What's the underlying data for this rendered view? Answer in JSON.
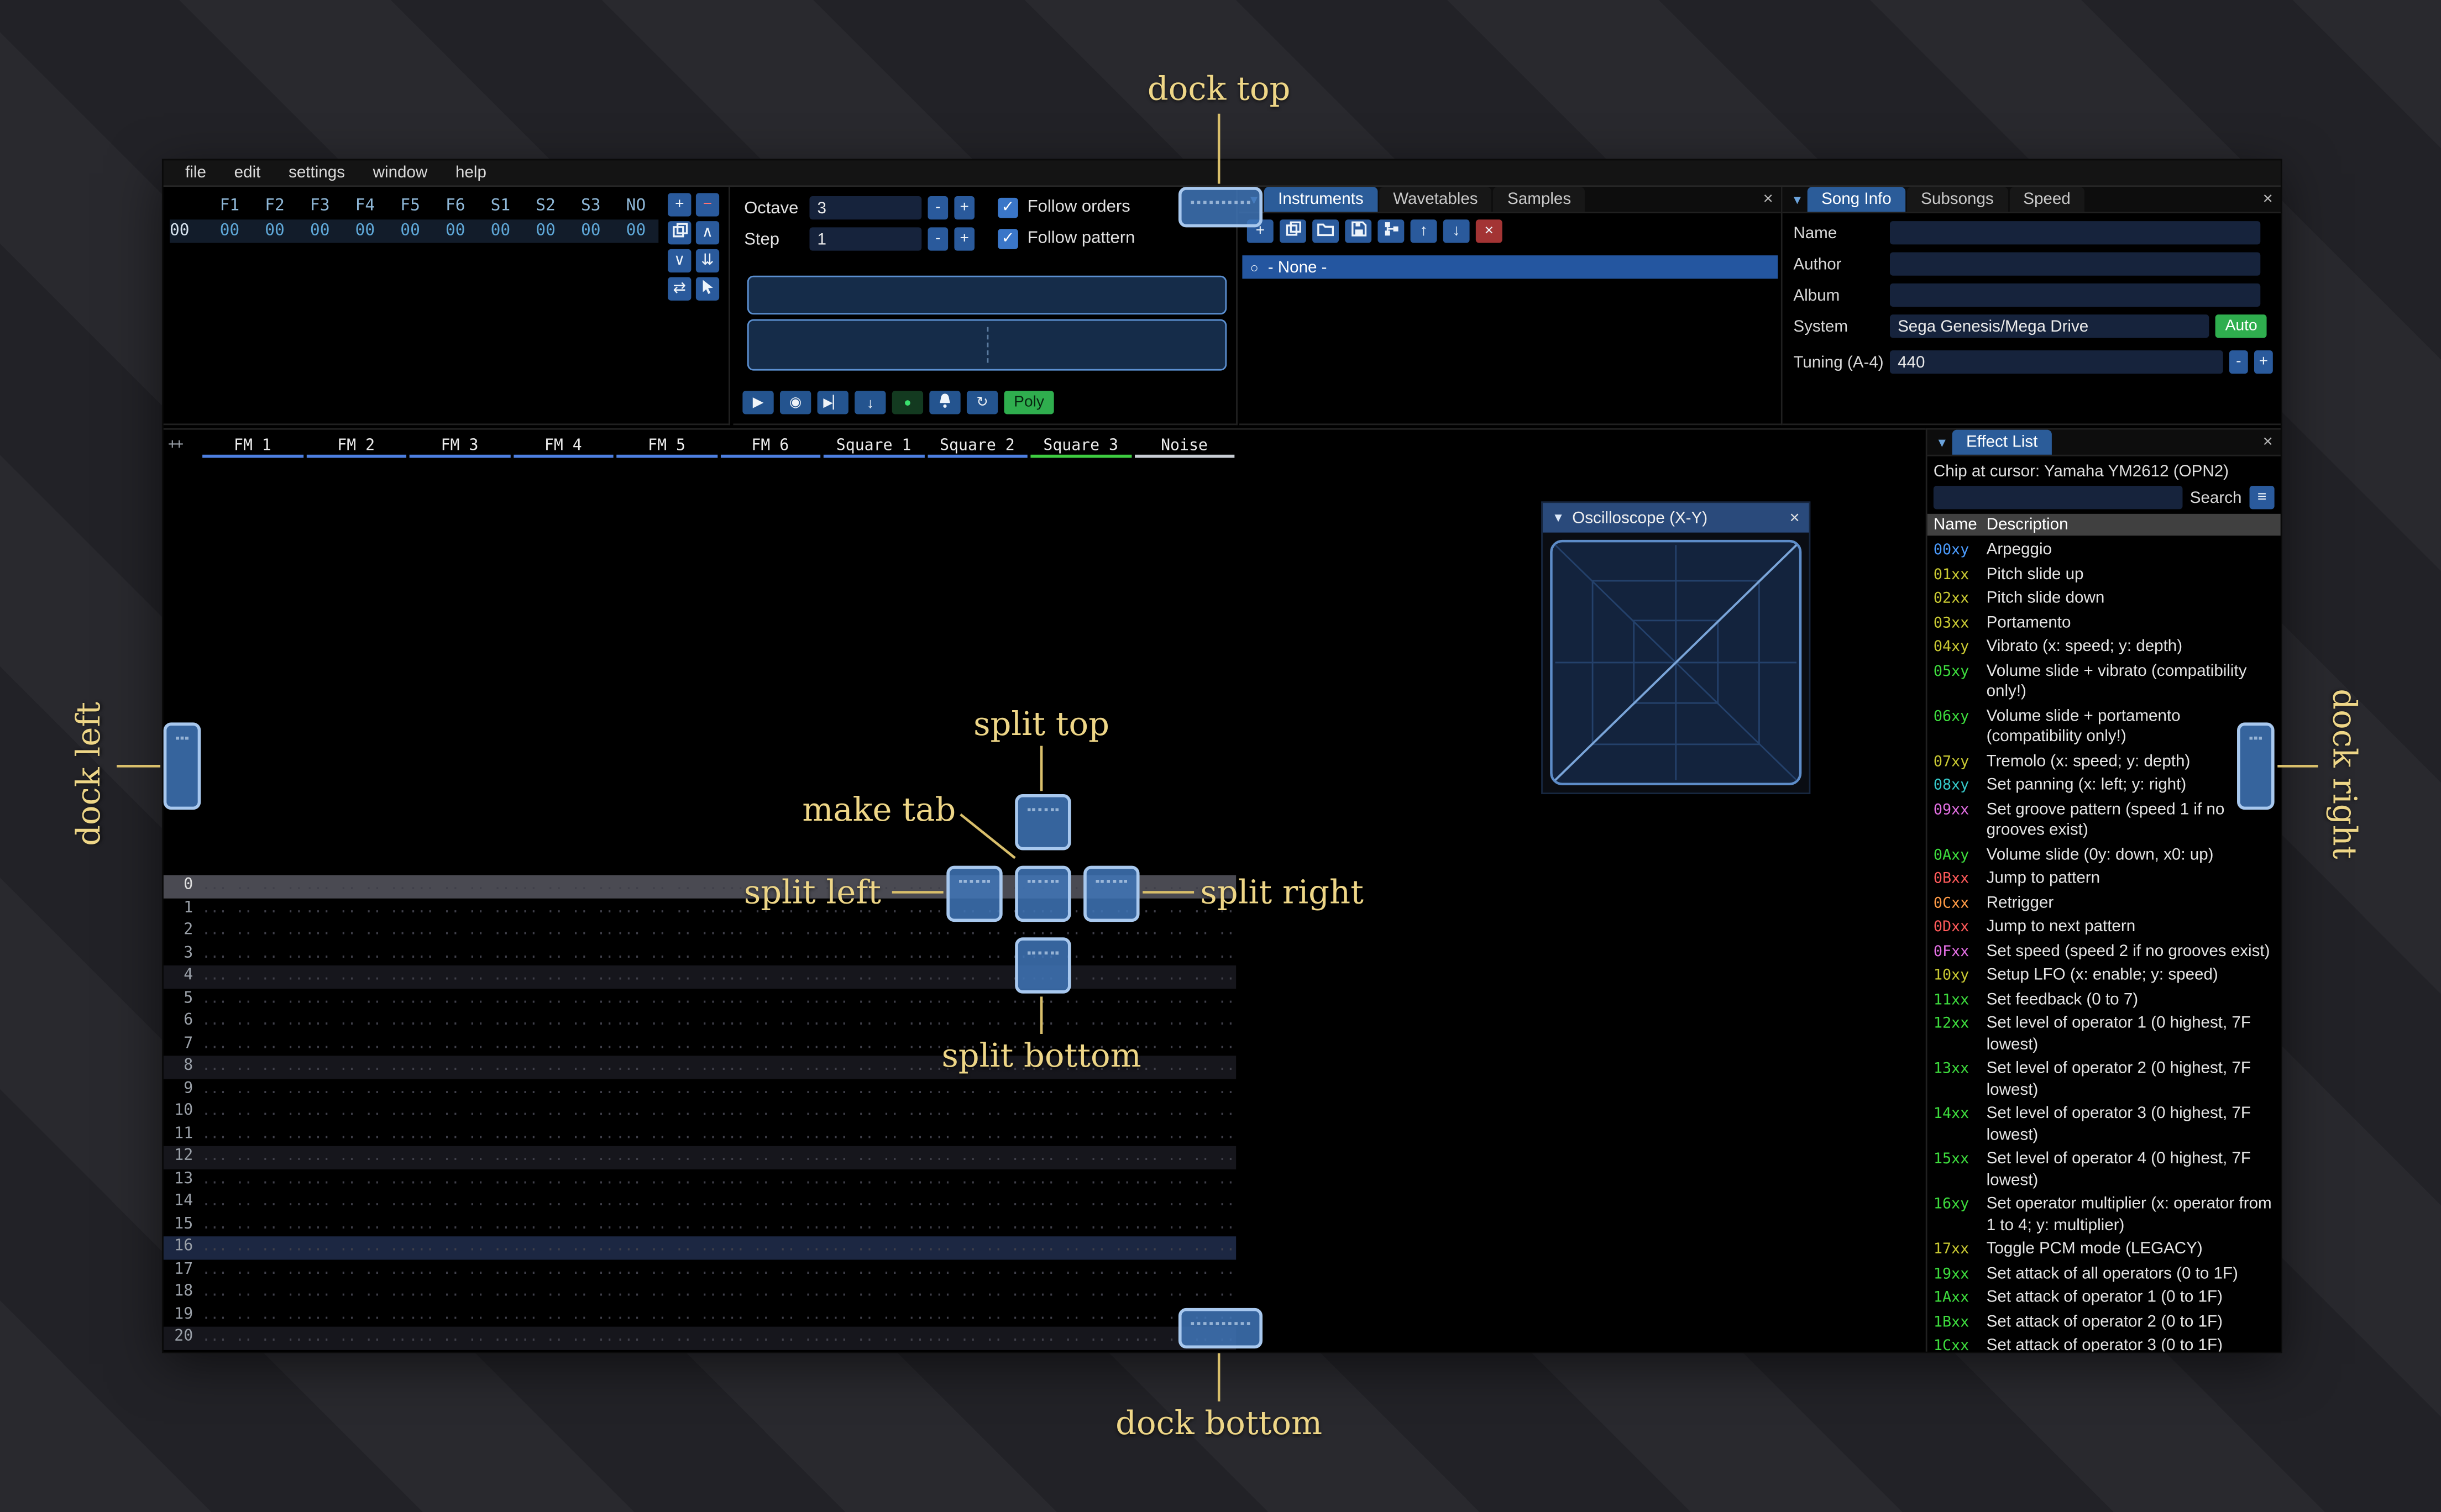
{
  "window": {
    "menu": [
      "file",
      "edit",
      "settings",
      "window",
      "help"
    ]
  },
  "icons": {
    "check": "✓",
    "collapse": "▼",
    "close": "×",
    "plus": "+",
    "minus": "−",
    "chevron_up": "∧",
    "chevron_down": "∨",
    "double_down": "⇊",
    "exchange": "⇄",
    "arrow_up": "↑",
    "arrow_down": "↓",
    "play": "▶",
    "play_pattern": "◉",
    "step": "▶▏",
    "step_row": "↓",
    "edit": "●",
    "repeat": "↻",
    "menu": "≡",
    "radio": "○"
  },
  "orders": {
    "row_index": "00",
    "channel_headers": [
      "F1",
      "F2",
      "F3",
      "F4",
      "F5",
      "F6",
      "S1",
      "S2",
      "S3",
      "NO"
    ],
    "row_values": [
      "00",
      "00",
      "00",
      "00",
      "00",
      "00",
      "00",
      "00",
      "00",
      "00"
    ]
  },
  "play_controls": {
    "octave_label": "Octave",
    "octave_value": "3",
    "step_label": "Step",
    "step_value": "1",
    "minus_label": "-",
    "plus_label": "+",
    "follow_orders_label": "Follow orders",
    "follow_pattern_label": "Follow pattern",
    "poly_label": "Poly"
  },
  "instruments_panel": {
    "tabs": [
      "Instruments",
      "Wavetables",
      "Samples"
    ],
    "active_tab": "Instruments",
    "selected_item": "- None -"
  },
  "song_info": {
    "tabs": [
      "Song Info",
      "Subsongs",
      "Speed"
    ],
    "active_tab": "Song Info",
    "fields": [
      {
        "label": "Name",
        "value": ""
      },
      {
        "label": "Author",
        "value": ""
      },
      {
        "label": "Album",
        "value": ""
      },
      {
        "label": "System",
        "value": "Sega Genesis/Mega Drive",
        "button": "Auto"
      },
      {
        "label": "Tuning (A-4)",
        "value": "440",
        "stepper": true
      }
    ]
  },
  "pattern": {
    "corner_label": "++",
    "channels": [
      {
        "name": "FM 1",
        "color": "#4d7fe0"
      },
      {
        "name": "FM 2",
        "color": "#4d7fe0"
      },
      {
        "name": "FM 3",
        "color": "#4d7fe0"
      },
      {
        "name": "FM 4",
        "color": "#4d7fe0"
      },
      {
        "name": "FM 5",
        "color": "#4d7fe0"
      },
      {
        "name": "FM 6",
        "color": "#4d7fe0"
      },
      {
        "name": "Square 1",
        "color": "#4d7fe0"
      },
      {
        "name": "Square 2",
        "color": "#4d7fe0"
      },
      {
        "name": "Square 3",
        "color": "#3ecc41"
      },
      {
        "name": "Noise",
        "color": "#c8cdd4"
      }
    ],
    "rows": 22,
    "empty_cell": "... .. .. ..",
    "highlight": {
      "cursor_row": 0,
      "minor_every": 4,
      "major_every": 16
    }
  },
  "oscilloscope": {
    "title": "Oscilloscope (X-Y)"
  },
  "effect_list": {
    "title": "Effect List",
    "chip_line": "Chip at cursor: Yamaha YM2612 (OPN2)",
    "search_label": "Search",
    "columns": [
      "Name",
      "Description"
    ],
    "effects": [
      {
        "code": "00xy",
        "desc": "Arpeggio",
        "color": "#4b9cff"
      },
      {
        "code": "01xx",
        "desc": "Pitch slide up",
        "color": "#c9c932"
      },
      {
        "code": "02xx",
        "desc": "Pitch slide down",
        "color": "#c9c932"
      },
      {
        "code": "03xx",
        "desc": "Portamento",
        "color": "#c9c932"
      },
      {
        "code": "04xy",
        "desc": "Vibrato (x: speed; y: depth)",
        "color": "#c9c932"
      },
      {
        "code": "05xy",
        "desc": "Volume slide + vibrato (compatibility only!)",
        "color": "#3ddc3d"
      },
      {
        "code": "06xy",
        "desc": "Volume slide + portamento (compatibility only!)",
        "color": "#3ddc3d"
      },
      {
        "code": "07xy",
        "desc": "Tremolo (x: speed; y: depth)",
        "color": "#c9c932"
      },
      {
        "code": "08xy",
        "desc": "Set panning (x: left; y: right)",
        "color": "#35c9c9"
      },
      {
        "code": "09xx",
        "desc": "Set groove pattern (speed 1 if no grooves exist)",
        "color": "#e36fe3"
      },
      {
        "code": "0Axy",
        "desc": "Volume slide (0y: down, x0: up)",
        "color": "#3ddc3d"
      },
      {
        "code": "0Bxx",
        "desc": "Jump to pattern",
        "color": "#ff5a5a"
      },
      {
        "code": "0Cxx",
        "desc": "Retrigger",
        "color": "#ff9a45"
      },
      {
        "code": "0Dxx",
        "desc": "Jump to next pattern",
        "color": "#ff5a5a"
      },
      {
        "code": "0Fxx",
        "desc": "Set speed (speed 2 if no grooves exist)",
        "color": "#e36fe3"
      },
      {
        "code": "10xy",
        "desc": "Setup LFO (x: enable; y: speed)",
        "color": "#c9c932"
      },
      {
        "code": "11xx",
        "desc": "Set feedback (0 to 7)",
        "color": "#3ddc3d"
      },
      {
        "code": "12xx",
        "desc": "Set level of operator 1 (0 highest, 7F lowest)",
        "color": "#3ddc3d"
      },
      {
        "code": "13xx",
        "desc": "Set level of operator 2 (0 highest, 7F lowest)",
        "color": "#3ddc3d"
      },
      {
        "code": "14xx",
        "desc": "Set level of operator 3 (0 highest, 7F lowest)",
        "color": "#3ddc3d"
      },
      {
        "code": "15xx",
        "desc": "Set level of operator 4 (0 highest, 7F lowest)",
        "color": "#3ddc3d"
      },
      {
        "code": "16xy",
        "desc": "Set operator multiplier (x: operator from 1 to 4; y: multiplier)",
        "color": "#3ddc3d"
      },
      {
        "code": "17xx",
        "desc": "Toggle PCM mode (LEGACY)",
        "color": "#c9c932"
      },
      {
        "code": "19xx",
        "desc": "Set attack of all operators (0 to 1F)",
        "color": "#3ddc3d"
      },
      {
        "code": "1Axx",
        "desc": "Set attack of operator 1 (0 to 1F)",
        "color": "#3ddc3d"
      },
      {
        "code": "1Bxx",
        "desc": "Set attack of operator 2 (0 to 1F)",
        "color": "#3ddc3d"
      },
      {
        "code": "1Cxx",
        "desc": "Set attack of operator 3 (0 to 1F)",
        "color": "#3ddc3d"
      }
    ]
  },
  "dock_overlay": {
    "accent_color": "#eed687",
    "labels": {
      "dock_top": "dock top",
      "dock_bottom": "dock bottom",
      "dock_left": "dock left",
      "dock_right": "dock right",
      "split_top": "split top",
      "split_bottom": "split bottom",
      "split_left": "split left",
      "split_right": "split right",
      "make_tab": "make tab"
    }
  }
}
